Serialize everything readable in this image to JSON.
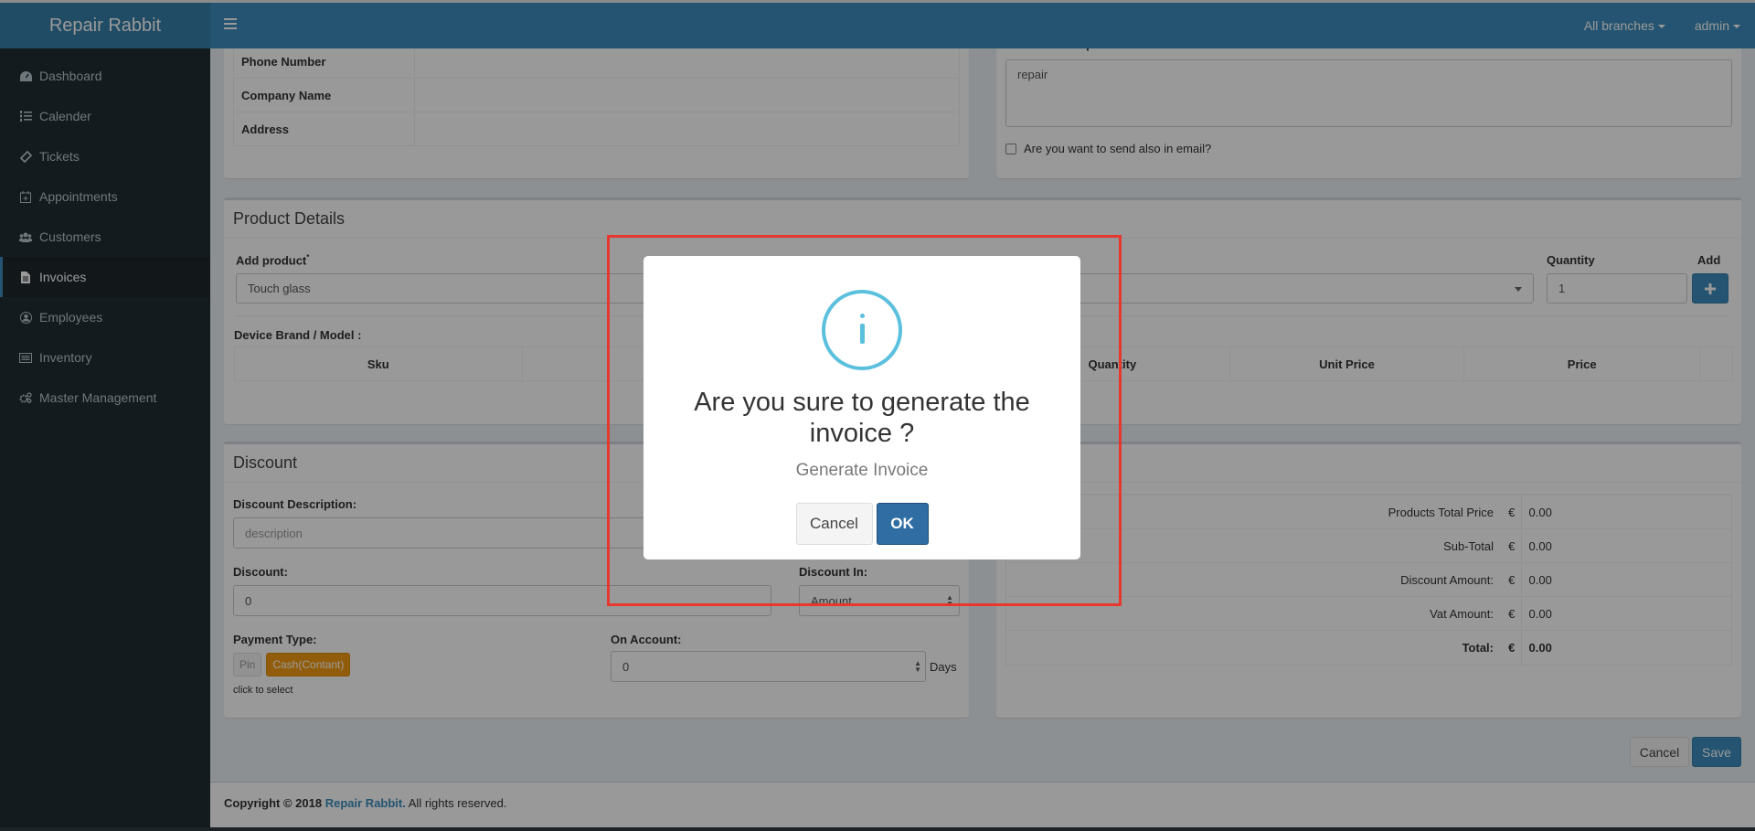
{
  "app": {
    "title": "Repair Rabbit"
  },
  "header": {
    "menu_icon": "hamburger-icon",
    "branches_label": "All branches",
    "user_label": "admin"
  },
  "sidebar": {
    "items": [
      {
        "label": "Dashboard",
        "icon": "dashboard-icon",
        "active": false
      },
      {
        "label": "Calender",
        "icon": "list-ol-icon",
        "active": false
      },
      {
        "label": "Tickets",
        "icon": "ticket-icon",
        "active": false
      },
      {
        "label": "Appointments",
        "icon": "calendar-plus-icon",
        "active": false
      },
      {
        "label": "Customers",
        "icon": "users-icon",
        "active": false
      },
      {
        "label": "Invoices",
        "icon": "file-text-icon",
        "active": true
      },
      {
        "label": "Employees",
        "icon": "user-circle-icon",
        "active": false
      },
      {
        "label": "Inventory",
        "icon": "list-alt-icon",
        "active": false
      },
      {
        "label": "Master Management",
        "icon": "cogs-icon",
        "active": false
      }
    ]
  },
  "customer_info": {
    "rows": [
      {
        "label": "Phone Number",
        "value": ""
      },
      {
        "label": "Company Name",
        "value": ""
      },
      {
        "label": "Address",
        "value": ""
      }
    ]
  },
  "invoice_info": {
    "description_label": "Invoice Description",
    "description_value": "repair",
    "email_checkbox_label": "Are you want to send also in email?",
    "email_checked": false
  },
  "product_details": {
    "title": "Product Details",
    "add_product_label": "Add product",
    "add_product_required": "*",
    "add_product_value": "Touch glass",
    "quantity_label": "Quantity",
    "quantity_value": "1",
    "add_label": "Add",
    "add_button_icon": "plus-icon",
    "device_label": "Device Brand / Model :",
    "columns": [
      "Sku",
      "",
      "",
      "Quantity",
      "Unit Price",
      "Price",
      ""
    ]
  },
  "discount": {
    "title": "Discount",
    "description_label": "Discount Description:",
    "description_placeholder": "description",
    "discount_label": "Discount:",
    "discount_value": "0",
    "discount_in_label": "Discount In:",
    "discount_in_value": "Amount",
    "payment_type_label": "Payment Type:",
    "payment_options": [
      {
        "label": "Pin",
        "selected": false
      },
      {
        "label": "Cash(Contant)",
        "selected": true
      }
    ],
    "payment_hint": "click to select",
    "on_account_label": "On Account:",
    "on_account_value": "0",
    "days_label": "Days"
  },
  "totals": {
    "currency": "€",
    "rows": [
      {
        "label": "Products Total Price",
        "value": "0.00",
        "bold": false
      },
      {
        "label": "Sub-Total",
        "value": "0.00",
        "bold": false
      },
      {
        "label": "Discount Amount:",
        "value": "0.00",
        "bold": false
      },
      {
        "label": "Vat Amount:",
        "value": "0.00",
        "bold": false
      },
      {
        "label": "Total:",
        "value": "0.00",
        "bold": true
      }
    ]
  },
  "actions": {
    "cancel_label": "Cancel",
    "save_label": "Save"
  },
  "footer": {
    "prefix": "Copyright © 2018",
    "brand": "Repair Rabbit.",
    "suffix": "All rights reserved."
  },
  "modal": {
    "icon": "info-icon",
    "title": "Are you sure to generate the invoice ?",
    "text": "Generate Invoice",
    "cancel_label": "Cancel",
    "ok_label": "OK"
  },
  "colors": {
    "brand": "#3c8dbc",
    "sidebar_bg": "#222d32",
    "warning": "#f39c12",
    "info": "#5bc0de",
    "highlight": "#e8372f"
  }
}
